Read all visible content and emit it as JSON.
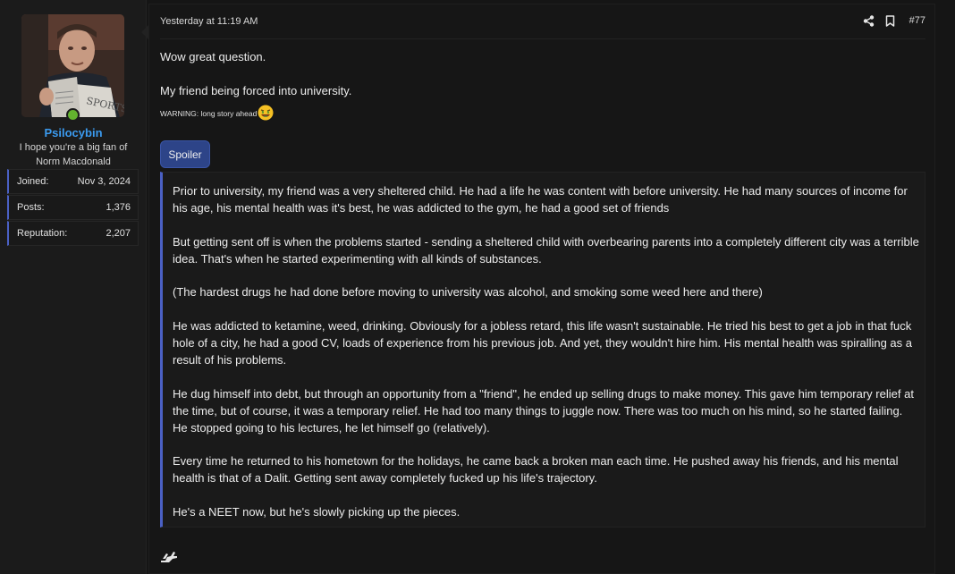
{
  "user": {
    "username": "Psilocybin",
    "title": "I hope you're a big fan of Norm Macdonald",
    "online": true,
    "stats": [
      {
        "label": "Joined:",
        "value": "Nov 3, 2024"
      },
      {
        "label": "Posts:",
        "value": "1,376"
      },
      {
        "label": "Reputation:",
        "value": "2,207"
      }
    ]
  },
  "post": {
    "timestamp": "Yesterday at 11:19 AM",
    "number": "#77",
    "line1": "Wow great question.",
    "line2": "My friend being forced into university.",
    "warning": "WARNING: long story ahead",
    "spoiler_label": "Spoiler",
    "spoiler_paragraphs": [
      "Prior to university, my friend was a very sheltered child. He had a life he was content with before university. He had many sources of income for his age, his mental health was it's best, he was addicted to the gym, he had a good set of friends",
      "But getting sent off is when the problems started - sending a sheltered child with overbearing parents into a completely different city was a terrible idea. That's when he started experimenting with all kinds of substances.",
      "(The hardest drugs he had done before moving to university was alcohol, and smoking some weed here and there)",
      "He was addicted to ketamine, weed, drinking. Obviously for a jobless retard, this life wasn't sustainable. He tried his best to get a job in that fuck hole of a city, he had a good CV, loads of experience from his previous job. And yet, they wouldn't hire him. His mental health was spiralling as a result of his problems.",
      "He dug himself into debt, but through an opportunity from a \"friend\", he ended up selling drugs to make money. This gave him temporary relief at the time, but of course, it was a temporary relief. He had too many things to juggle now. There was too much on his mind, so he started failing. He stopped going to his lectures, he let himself go (relatively).",
      "Every time he returned to his hometown for the holidays, he came back a broken man each time. He pushed away his friends, and his mental health is that of a Dalit. Getting sent away completely fucked up his life's trajectory.",
      "He's a NEET now, but he's slowly picking up the pieces."
    ]
  },
  "icons": {
    "share": "share-icon",
    "bookmark": "bookmark-icon",
    "emoji": "grinning-money-emoji",
    "reaction": "reaction-icon"
  },
  "colors": {
    "username": "#3b9bf0",
    "accent": "#4a60c4",
    "spoiler_button": "#2d4488",
    "online": "#63b32e"
  }
}
